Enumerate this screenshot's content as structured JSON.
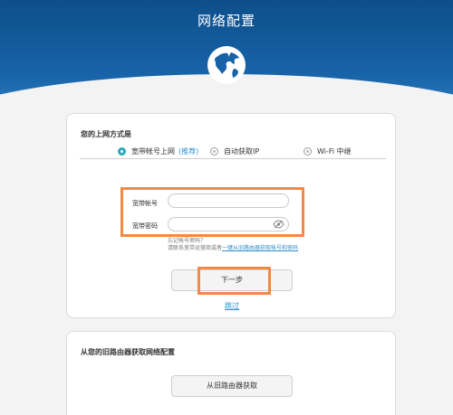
{
  "header": {
    "title": "网络配置",
    "icon": "globe-icon"
  },
  "method": {
    "label": "您的上网方式是",
    "options": [
      {
        "label": "宽带帐号上网",
        "tag": "(推荐)",
        "selected": true
      },
      {
        "label": "自动获取IP",
        "selected": false
      },
      {
        "label": "Wi-Fi 中继",
        "selected": false
      }
    ]
  },
  "form": {
    "account_label": "宽带帐号",
    "account_value": "",
    "password_label": "宽带密码",
    "password_value": "",
    "forgot_line1": "忘记帐号密码？",
    "forgot_line2_prefix": "请联系宽带运营商或者",
    "forgot_link": "一键从旧路由器获取帐号和密码"
  },
  "actions": {
    "next_label": "下一步",
    "skip_label": "跳过"
  },
  "old_router": {
    "title": "从您的旧路由器获取网络配置",
    "button_label": "从旧路由器获取"
  },
  "colors": {
    "header": "#1863a8",
    "accent": "#29a9b9",
    "highlight": "#f28a45",
    "link": "#2c8fcf"
  }
}
